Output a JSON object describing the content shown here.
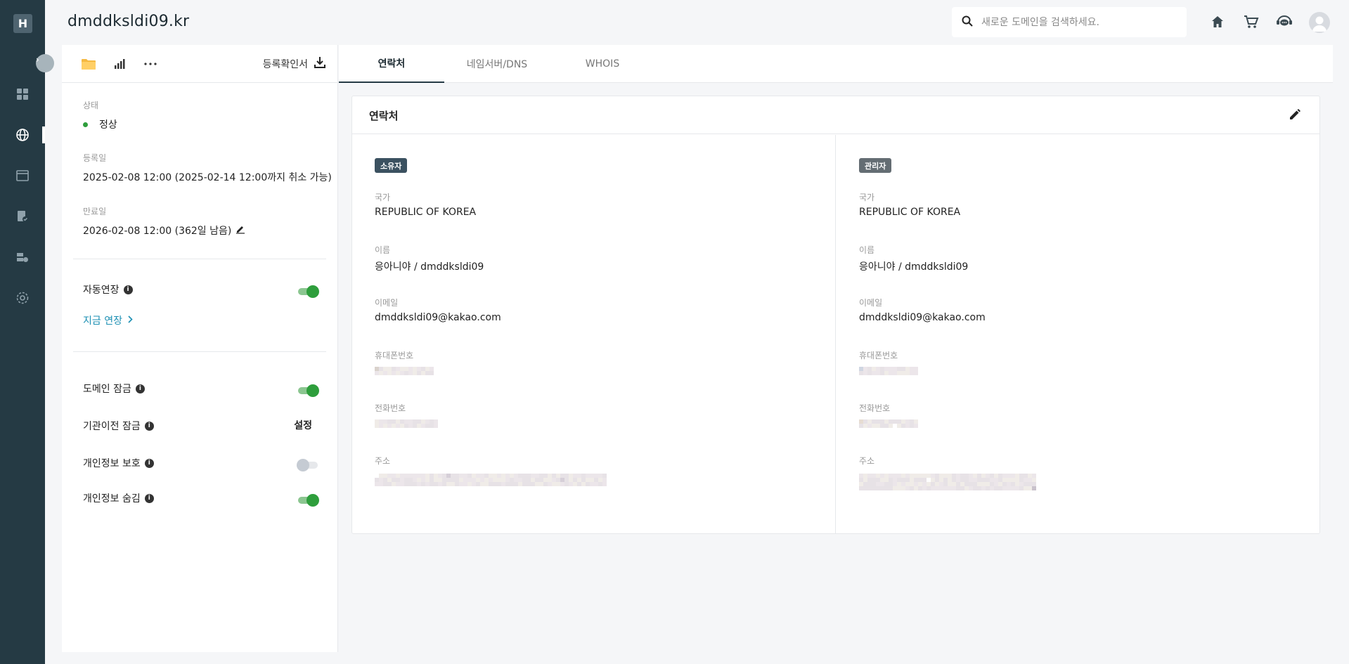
{
  "app": {
    "logo_letter": "H",
    "domain_title": "dmddksldi09.kr",
    "colors": {
      "rail": "#253a44",
      "accent_green": "#2e9e3c",
      "link": "#1b8fb3"
    }
  },
  "rail": {
    "icons": [
      "dashboard-icon",
      "globe-icon",
      "browser-window-icon",
      "document-check-icon",
      "server-settings-icon",
      "settings-icon"
    ],
    "active": "globe-icon"
  },
  "header": {
    "search_placeholder": "새로운 도메인을 검색하세요.",
    "icons": [
      "home-icon",
      "cart-icon",
      "support-chat-icon",
      "user-avatar-icon"
    ]
  },
  "left_panel": {
    "toolbar": {
      "icons": [
        "folder-icon",
        "bar-chart-icon",
        "more-icon"
      ],
      "certificate_label": "등록확인서"
    },
    "status": {
      "label": "상태",
      "value": "정상"
    },
    "registered": {
      "label": "등록일",
      "value": "2025-02-08 12:00 (2025-02-14 12:00까지 취소 가능)"
    },
    "expires": {
      "label": "만료일",
      "value": "2026-02-08 12:00 (362일 남음)"
    },
    "auto_renew": {
      "label": "자동연장",
      "on": true
    },
    "renew_now": "지금 연장",
    "domain_lock": {
      "label": "도메인 잠금",
      "on": true
    },
    "transfer_lock": {
      "label": "기관이전 잠금",
      "action": "설정"
    },
    "privacy_protect": {
      "label": "개인정보 보호",
      "on": false
    },
    "privacy_hide": {
      "label": "개인정보 숨김",
      "on": true
    }
  },
  "tabs": [
    {
      "label": "연락처",
      "active": true
    },
    {
      "label": "네임서버/DNS",
      "active": false
    },
    {
      "label": "WHOIS",
      "active": false
    }
  ],
  "contact_card": {
    "title": "연락처",
    "owner": {
      "badge": "소유자",
      "country_label": "국가",
      "country": "REPUBLIC OF KOREA",
      "name_label": "이름",
      "name": "응아니야 / dmddksldi09",
      "email_label": "이메일",
      "email": "dmddksldi09@kakao.com",
      "mobile_label": "휴대폰번호",
      "phone_label": "전화번호",
      "address_label": "주소"
    },
    "admin": {
      "badge": "관리자",
      "country_label": "국가",
      "country": "REPUBLIC OF KOREA",
      "name_label": "이름",
      "name": "응아니야 / dmddksldi09",
      "email_label": "이메일",
      "email": "dmddksldi09@kakao.com",
      "mobile_label": "휴대폰번호",
      "phone_label": "전화번호",
      "address_label": "주소"
    }
  }
}
